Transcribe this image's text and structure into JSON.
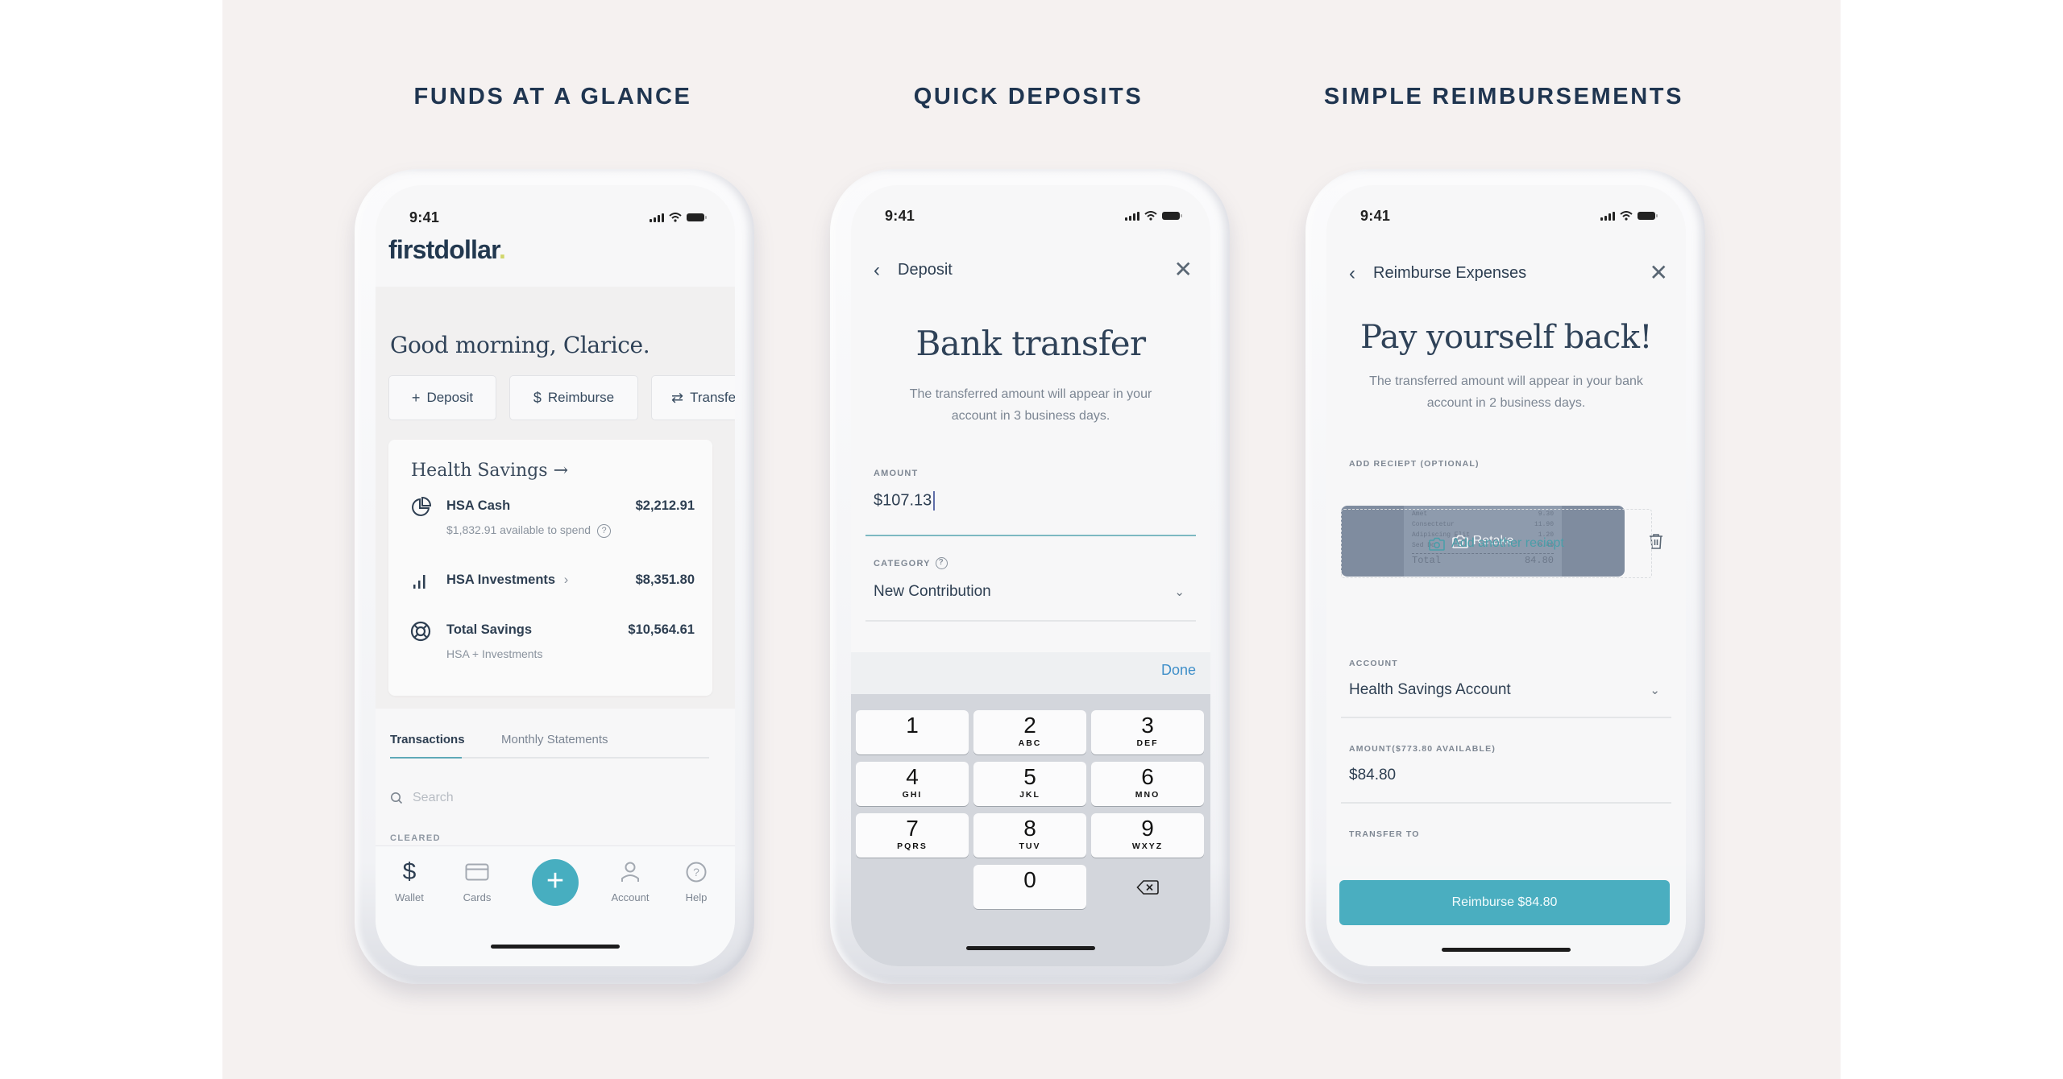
{
  "headings": [
    "FUNDS AT A GLANCE",
    "QUICK DEPOSITS",
    "SIMPLE REIMBURSEMENTS"
  ],
  "status_time": "9:41",
  "home": {
    "logo_text": "firstdollar",
    "logo_dot": ".",
    "greeting": "Good morning, Clarice.",
    "quick_actions": [
      {
        "icon": "plus-icon",
        "glyph": "+",
        "label": "Deposit"
      },
      {
        "icon": "dollar-icon",
        "glyph": "$",
        "label": "Reimburse"
      },
      {
        "icon": "transfer-icon",
        "glyph": "⇄",
        "label": "Transfe"
      }
    ],
    "health_savings": {
      "title": "Health Savings",
      "arrow": "→",
      "rows": [
        {
          "icon": "pie-chart-icon",
          "label": "HSA Cash",
          "value": "$2,212.91",
          "sub": "$1,832.91 available to spend",
          "help": "?"
        },
        {
          "icon": "bar-chart-icon",
          "label": "HSA Investments",
          "chevron": "›",
          "value": "$8,351.80"
        },
        {
          "icon": "lifebuoy-icon",
          "label": "Total Savings",
          "value": "$10,564.61",
          "sub": "HSA + Investments"
        }
      ]
    },
    "tabs": [
      {
        "label": "Transactions",
        "active": true
      },
      {
        "label": "Monthly Statements",
        "active": false
      }
    ],
    "search_placeholder": "Search",
    "section_label": "CLEARED",
    "tabbar": [
      {
        "icon": "dollar-icon",
        "label": "Wallet"
      },
      {
        "icon": "card-icon",
        "label": "Cards"
      },
      {
        "icon": "plus-icon",
        "label": ""
      },
      {
        "icon": "user-icon",
        "label": "Account"
      },
      {
        "icon": "help-icon",
        "label": "Help"
      }
    ],
    "fab_glyph": "+",
    "accent": "#47aec0"
  },
  "deposit": {
    "nav_back": "‹",
    "nav_title": "Deposit",
    "nav_close": "✕",
    "title": "Bank transfer",
    "subtitle": "The transferred amount will appear in your account in 3 business days.",
    "amount_label": "AMOUNT",
    "amount_value": "$107.13",
    "category_label": "CATEGORY",
    "category_help": "?",
    "category_value": "New Contribution",
    "done_label": "Done",
    "keys": [
      {
        "num": "1",
        "letters": ""
      },
      {
        "num": "2",
        "letters": "ABC"
      },
      {
        "num": "3",
        "letters": "DEF"
      },
      {
        "num": "4",
        "letters": "GHI"
      },
      {
        "num": "5",
        "letters": "JKL"
      },
      {
        "num": "6",
        "letters": "MNO"
      },
      {
        "num": "7",
        "letters": "PQRS"
      },
      {
        "num": "8",
        "letters": "TUV"
      },
      {
        "num": "9",
        "letters": "WXYZ"
      },
      {
        "num": "0",
        "letters": ""
      }
    ]
  },
  "reimburse": {
    "nav_back": "‹",
    "nav_title": "Reimburse Expenses",
    "nav_close": "✕",
    "title": "Pay yourself back!",
    "subtitle": "The transferred amount will appear in your bank account in 2 business days.",
    "receipt_label": "ADD RECIEPT (OPTIONAL)",
    "receipt_lines": [
      {
        "item": "Amet",
        "amt": "9.30"
      },
      {
        "item": "Consectetur",
        "amt": "11.90"
      },
      {
        "item": "Adipiscing Elit",
        "amt": "1.20"
      },
      {
        "item": "Sed Do",
        "amt": "0.40"
      }
    ],
    "receipt_total_label": "Total",
    "receipt_total": "84.80",
    "retake_label": "Retake",
    "add_receipt_label": "Add another reciept",
    "account_label": "ACCOUNT",
    "account_value": "Health Savings Account",
    "amount_label": "AMOUNT($773.80 AVAILABLE)",
    "amount_value": "$84.80",
    "transfer_label": "TRANSFER TO",
    "button_label": "Reimburse $84.80"
  }
}
